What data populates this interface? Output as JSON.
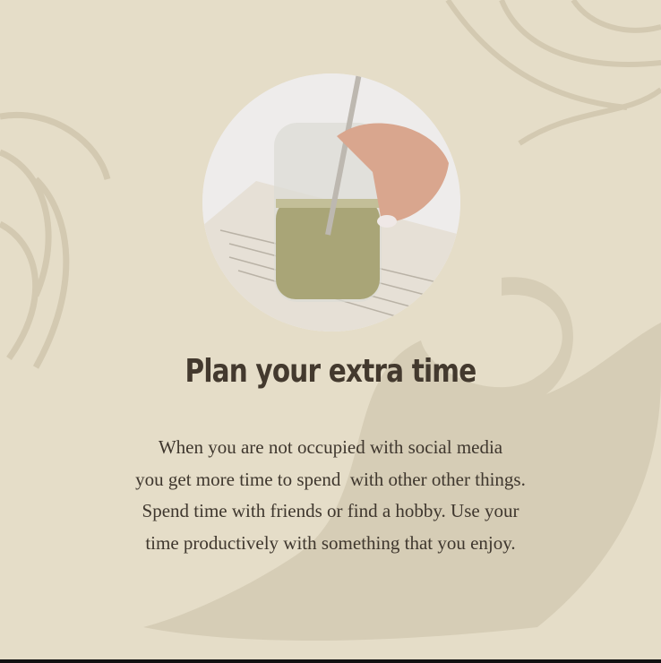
{
  "post": {
    "title": "Plan your extra time",
    "body_lines": [
      "When you are not occupied with social media",
      "you get more time to spend  with other other things.",
      "Spend time with friends or find a hobby. Use your",
      "time productively with something that you enjoy."
    ]
  },
  "colors": {
    "background": "#e5ddc8",
    "shape": "#d6cdb6",
    "text": "#43392e"
  }
}
